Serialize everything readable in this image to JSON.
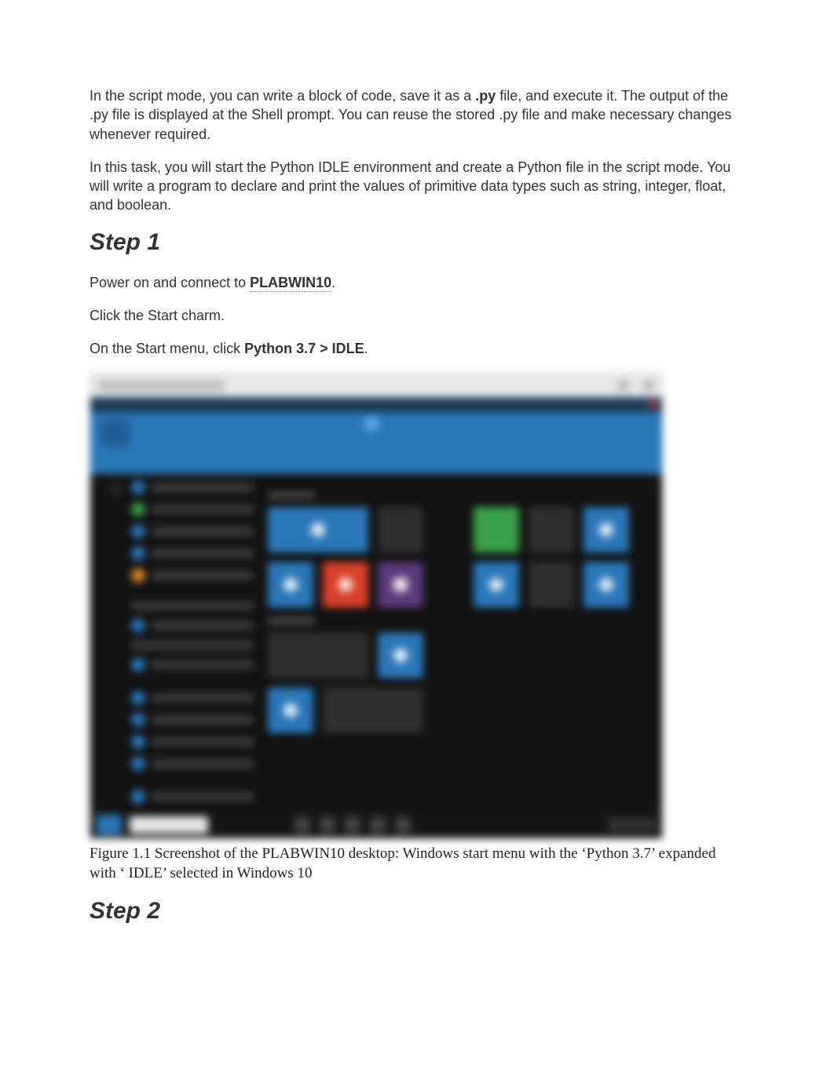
{
  "intro": {
    "p1_a": "In the script mode, you can write a block of code, save it as a ",
    "p1_bold": ".py",
    "p1_b": " file, and execute it. The output of the .py file is displayed at the Shell prompt. You can reuse the stored .py file and make necessary changes whenever required.",
    "p2": "In this task, you will start the Python IDLE environment and create a Python file in the script mode. You will write a program to declare and print the values of primitive data types such as string, integer, float, and boolean."
  },
  "step1": {
    "heading": "Step 1",
    "p1_a": "Power on and connect to ",
    "p1_bold": "PLABWIN10",
    "p1_b": ".",
    "p2": "Click the Start charm.",
    "p3_a": "On the Start menu, click ",
    "p3_bold": "Python 3.7 > IDLE",
    "p3_b": "."
  },
  "figure": {
    "caption": "Figure 1.1 Screenshot of the PLABWIN10 desktop: Windows start menu with the ‘Python 3.7’ expanded with ‘ IDLE’ selected in Windows 10"
  },
  "step2": {
    "heading": "Step 2"
  }
}
